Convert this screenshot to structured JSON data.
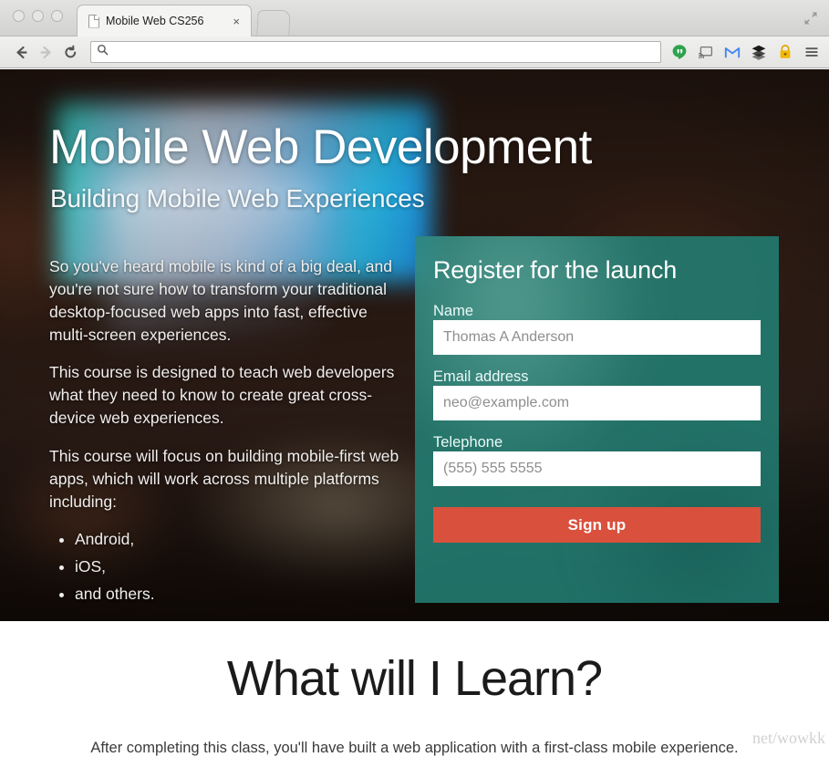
{
  "browser": {
    "window_controls": [
      "close",
      "minimize",
      "zoom"
    ],
    "tab": {
      "title": "Mobile Web CS256",
      "favicon": "page-icon",
      "close_label": "×"
    },
    "new_tab_label": "",
    "fullscreen_icon": "expand-arrows-icon",
    "nav": {
      "back_icon": "back-arrow-icon",
      "forward_icon": "forward-arrow-icon",
      "reload_icon": "reload-icon"
    },
    "omnibox": {
      "value": "",
      "placeholder": "",
      "search_icon": "search-icon"
    },
    "extensions": [
      {
        "name": "hangouts-icon",
        "color": "#2EA24C"
      },
      {
        "name": "cast-icon",
        "color": "#6E6E6E"
      },
      {
        "name": "gmail-icon",
        "color": "#4285F4"
      },
      {
        "name": "buffer-icon",
        "color": "#1A1A1A"
      },
      {
        "name": "lastpass-icon",
        "color": "#F2B705"
      },
      {
        "name": "menu-icon",
        "color": "#5A5A5A"
      }
    ]
  },
  "hero": {
    "title": "Mobile Web Development",
    "subtitle": "Building Mobile Web Experiences",
    "paragraphs": [
      "So you've heard mobile is kind of a big deal, and you're not sure how to transform your traditional desktop-focused web apps into fast, effective multi-screen experiences.",
      "This course is designed to teach web developers what they need to know to create great cross-device web experiences.",
      "This course will focus on building mobile-first web apps, which will work across multiple platforms including:"
    ],
    "bullets": [
      "Android,",
      "iOS,",
      "and others."
    ]
  },
  "register": {
    "heading": "Register for the launch",
    "panel_color": "#227E74",
    "fields": [
      {
        "label": "Name",
        "placeholder": "Thomas A Anderson",
        "value": ""
      },
      {
        "label": "Email address",
        "placeholder": "neo@example.com",
        "value": ""
      },
      {
        "label": "Telephone",
        "placeholder": "(555) 555 5555",
        "value": ""
      }
    ],
    "submit_label": "Sign up",
    "submit_color": "#D9503C"
  },
  "learn": {
    "title": "What will I Learn?",
    "subtitle": "After completing this class, you'll have built a web application with a first-class mobile experience."
  },
  "watermark": {
    "text": "net/wowkk"
  }
}
